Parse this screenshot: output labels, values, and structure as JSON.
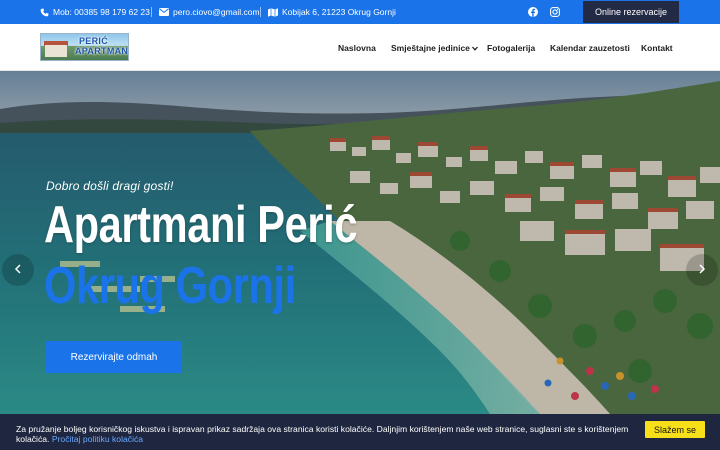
{
  "topbar": {
    "phone": "Mob: 00385 98 179 62 23",
    "email": "pero.ciovo@gmail.com",
    "address": "Kobijak 6, 21223 Okrug Gornji",
    "social": [
      "facebook-icon",
      "instagram-icon"
    ],
    "online_button": "Online rezervacije"
  },
  "logo": {
    "line1": "PERIĆ",
    "line2": "APARTMANI"
  },
  "nav": {
    "items": [
      "Naslovna",
      "Smještajne jedinice",
      "Fotogalerija",
      "Kalendar zauzetosti",
      "Kontakt"
    ]
  },
  "hero": {
    "welcome": "Dobro došli dragi gosti!",
    "title_line1": "Apartmani Perić",
    "title_line2": "Okrug Gornji",
    "cta": "Rezervirajte odmah"
  },
  "cookie": {
    "message": "Za pružanje boljeg korisničkog iskustva i ispravan prikaz sadržaja ova stranica koristi kolačiće. Daljnjim korištenjem naše web stranice, suglasni ste s korištenjem kolačića.",
    "link": "Pročitaj politiku kolačića",
    "accept": "Slažem se"
  },
  "colors": {
    "accent": "#1a73e8",
    "dark_button": "#232a45",
    "cookie_bg": "#1f2740",
    "cookie_accept": "#f7e01a"
  }
}
